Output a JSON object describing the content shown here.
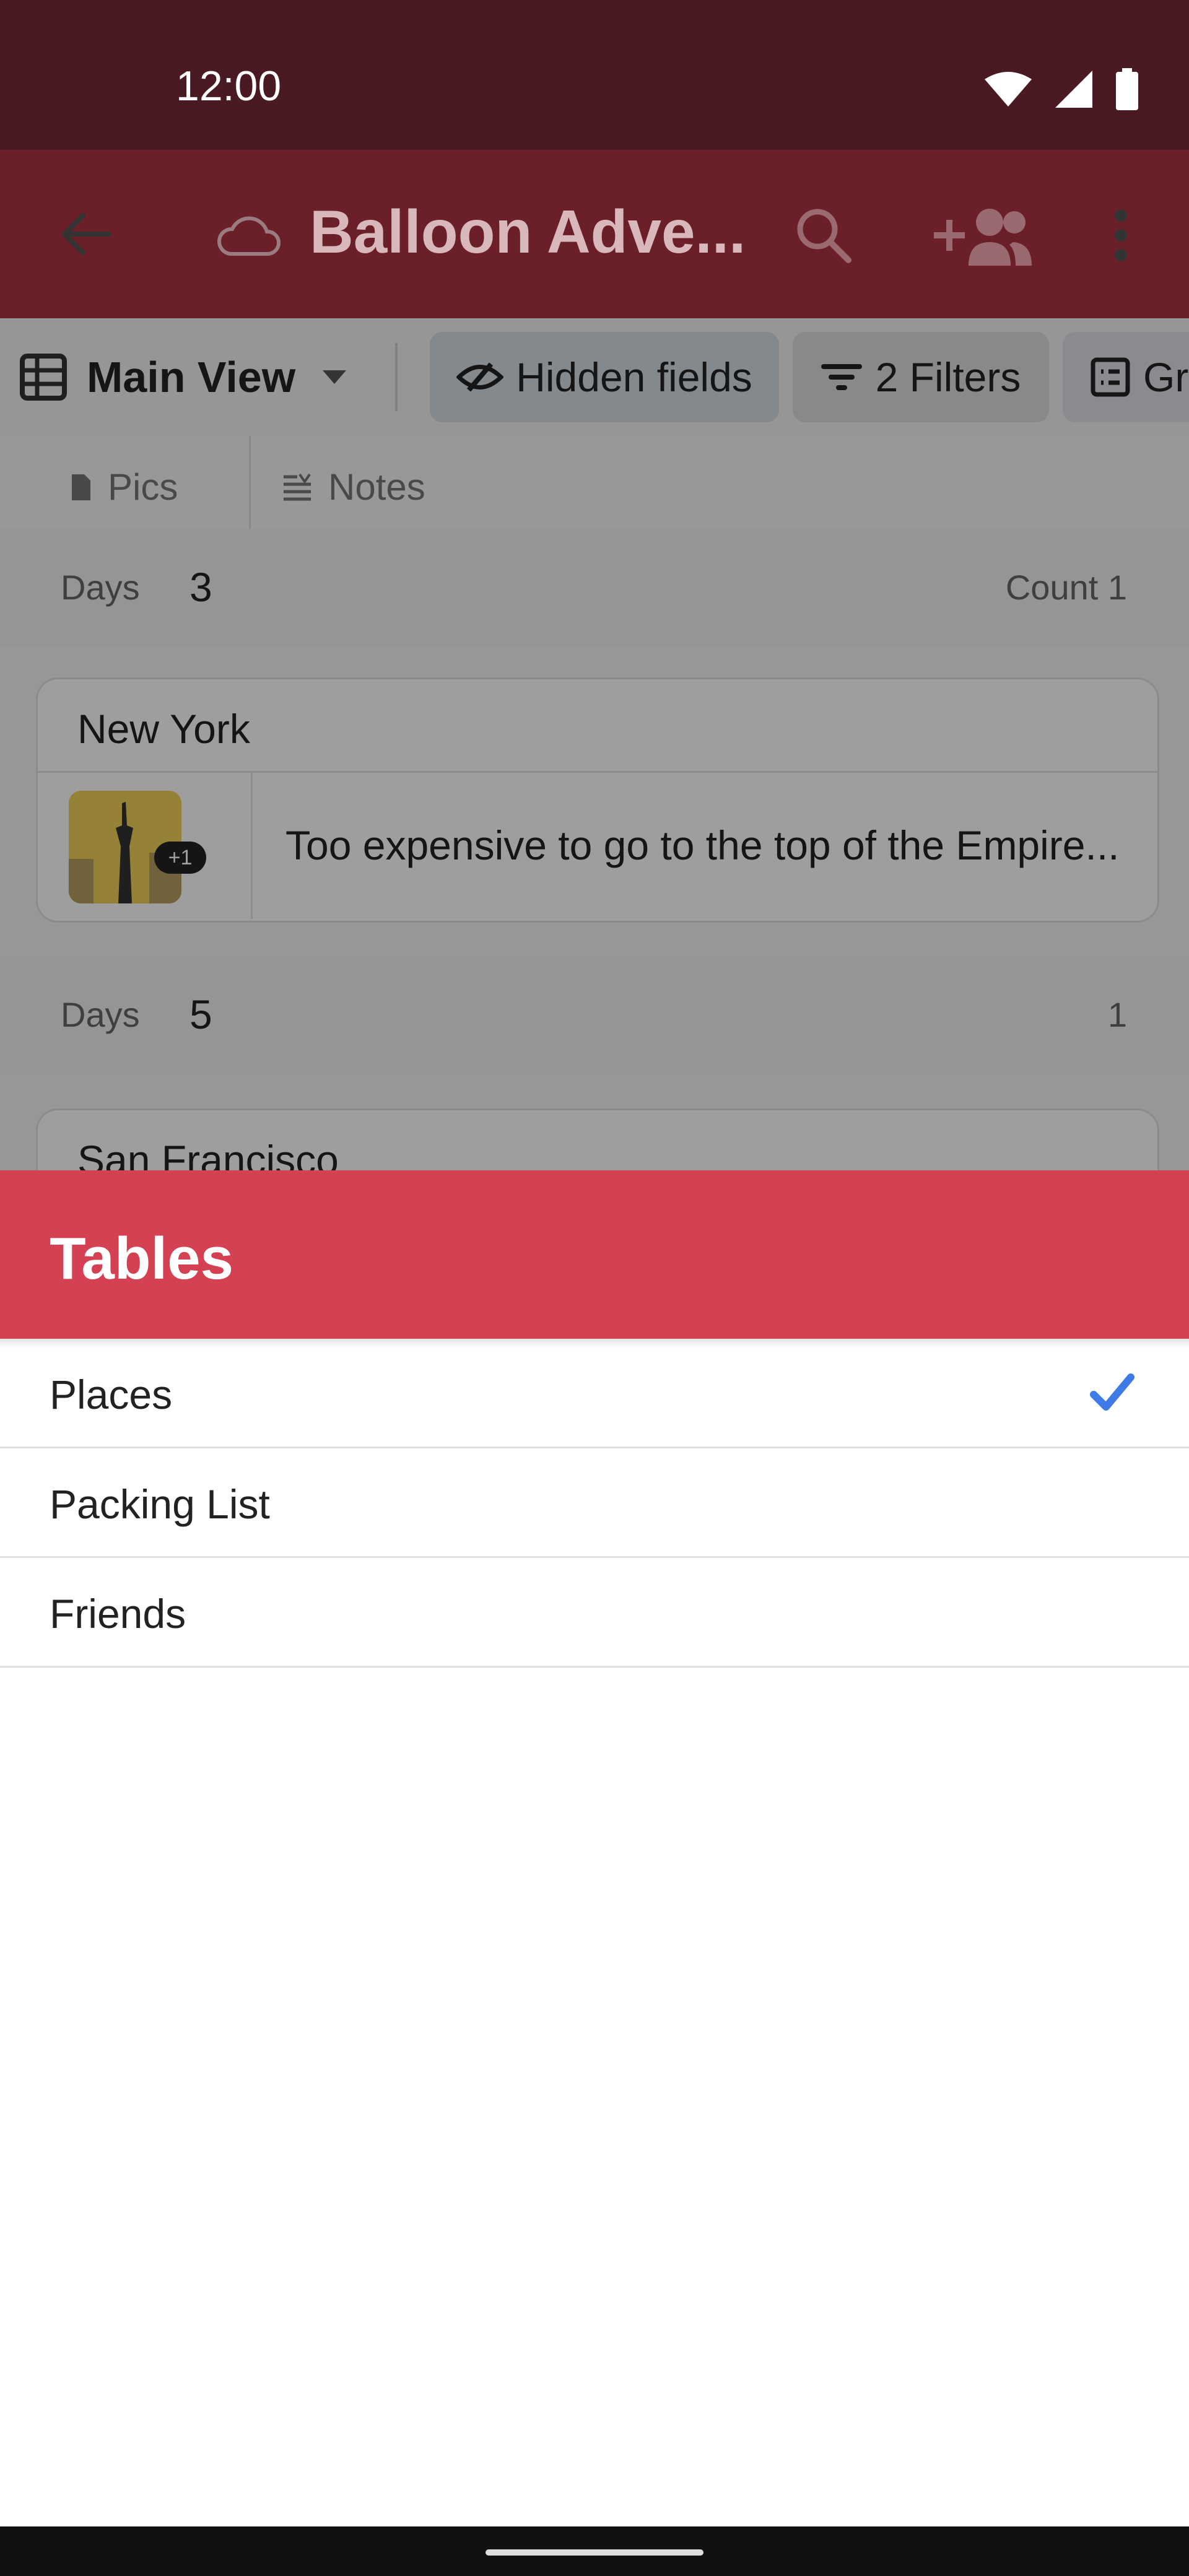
{
  "status": {
    "time": "12:00"
  },
  "app": {
    "title": "Balloon Adve..."
  },
  "toolbar": {
    "main_view": "Main View",
    "hidden_fields": "Hidden fields",
    "filters": "2 Filters",
    "group_partial": "Gr"
  },
  "fields": {
    "pics": "Pics",
    "notes": "Notes"
  },
  "groups": [
    {
      "label": "Days",
      "value": "3",
      "count": "Count 1"
    },
    {
      "label": "Days",
      "value": "5",
      "count": "1"
    }
  ],
  "cards": [
    {
      "title": "New York",
      "note": "Too expensive to go to the top of the Empire...",
      "badge": "+1"
    },
    {
      "title": "San Francisco"
    }
  ],
  "sheet": {
    "title": "Tables",
    "items": [
      {
        "label": "Places",
        "selected": true
      },
      {
        "label": "Packing List",
        "selected": false
      },
      {
        "label": "Friends",
        "selected": false
      }
    ]
  },
  "colors": {
    "status_bar": "#4a1a22",
    "app_bar": "#6a1f29",
    "sheet_header": "#d34152",
    "check": "#3f7be6"
  },
  "icons": [
    "wifi-icon",
    "signal-icon",
    "battery-icon",
    "back-arrow-icon",
    "cloud-icon",
    "search-icon",
    "add-user-icon",
    "more-vert-icon",
    "grid-icon",
    "dropdown-icon",
    "hidden-eye-icon",
    "filter-icon",
    "group-icon",
    "file-icon",
    "notes-icon",
    "check-icon"
  ]
}
